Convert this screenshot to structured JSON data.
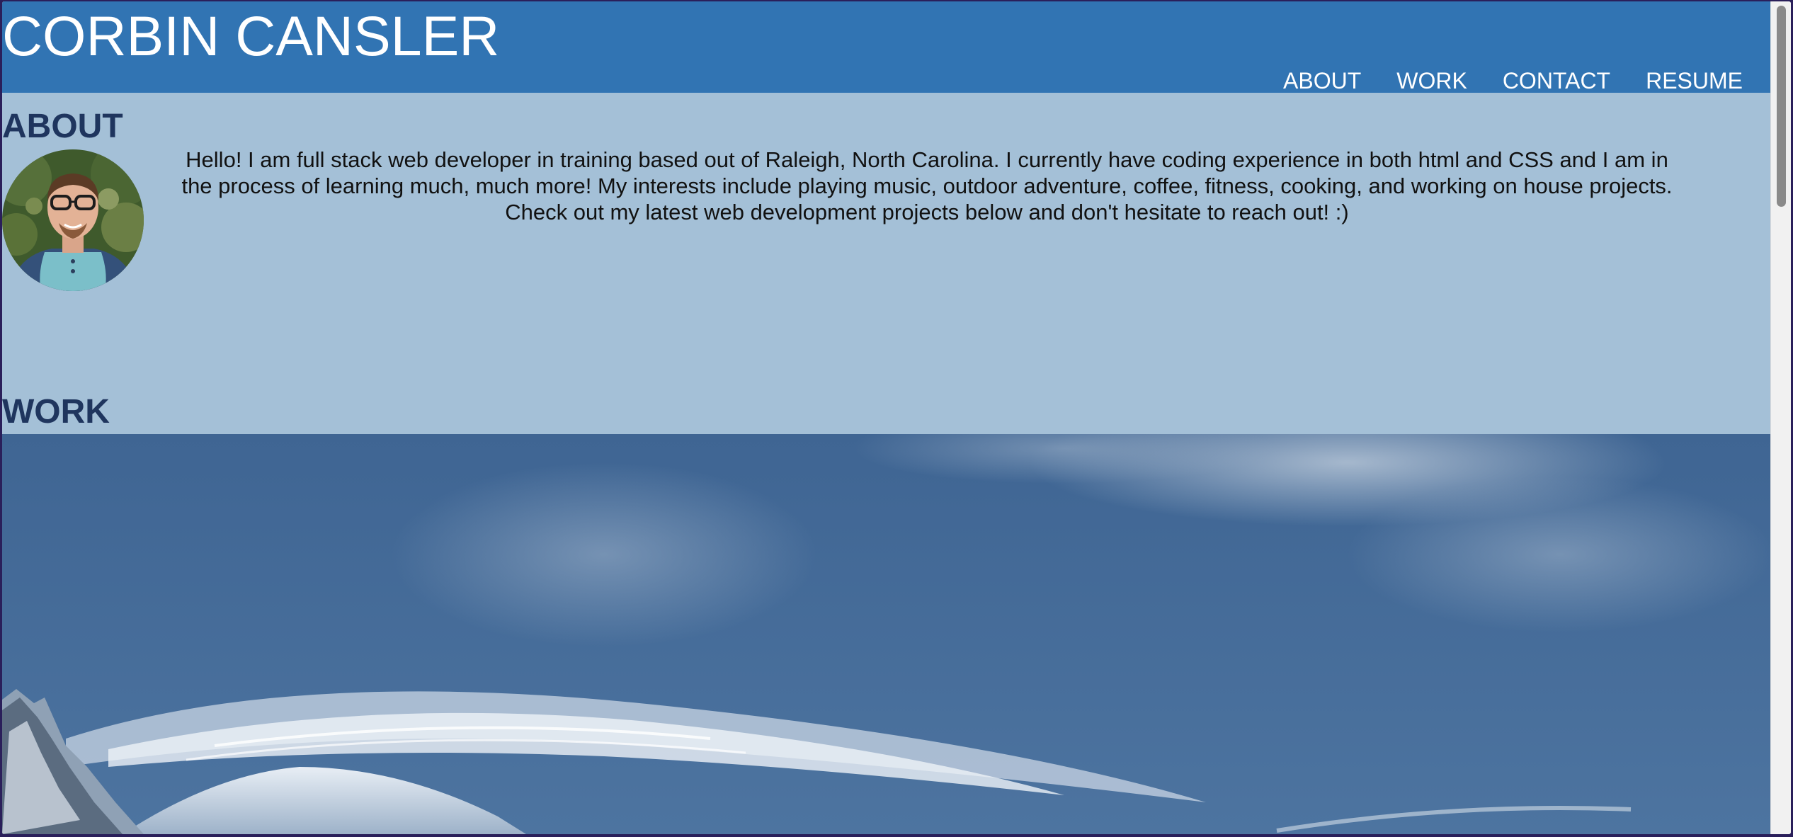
{
  "header": {
    "title": "CORBIN CANSLER",
    "nav": [
      {
        "label": "ABOUT"
      },
      {
        "label": "WORK"
      },
      {
        "label": "CONTACT"
      },
      {
        "label": "RESUME"
      }
    ]
  },
  "about": {
    "heading": "ABOUT",
    "bio": "Hello! I am full stack web developer in training based out of Raleigh, North Carolina. I currently have coding experience in both html and CSS and I am in the process of learning much, much more! My interests include playing music, outdoor adventure, coffee, fitness, cooking, and working on house projects. Check out my latest web development projects below and don't hesitate to reach out! :)"
  },
  "work": {
    "heading": "WORK"
  },
  "colors": {
    "header_bg": "#3174b3",
    "about_bg": "#a4c0d7",
    "heading_text": "#1f355e",
    "sky": "#4a6f9a"
  },
  "icons": {
    "avatar": "profile-photo",
    "hero": "mountain-landscape"
  }
}
